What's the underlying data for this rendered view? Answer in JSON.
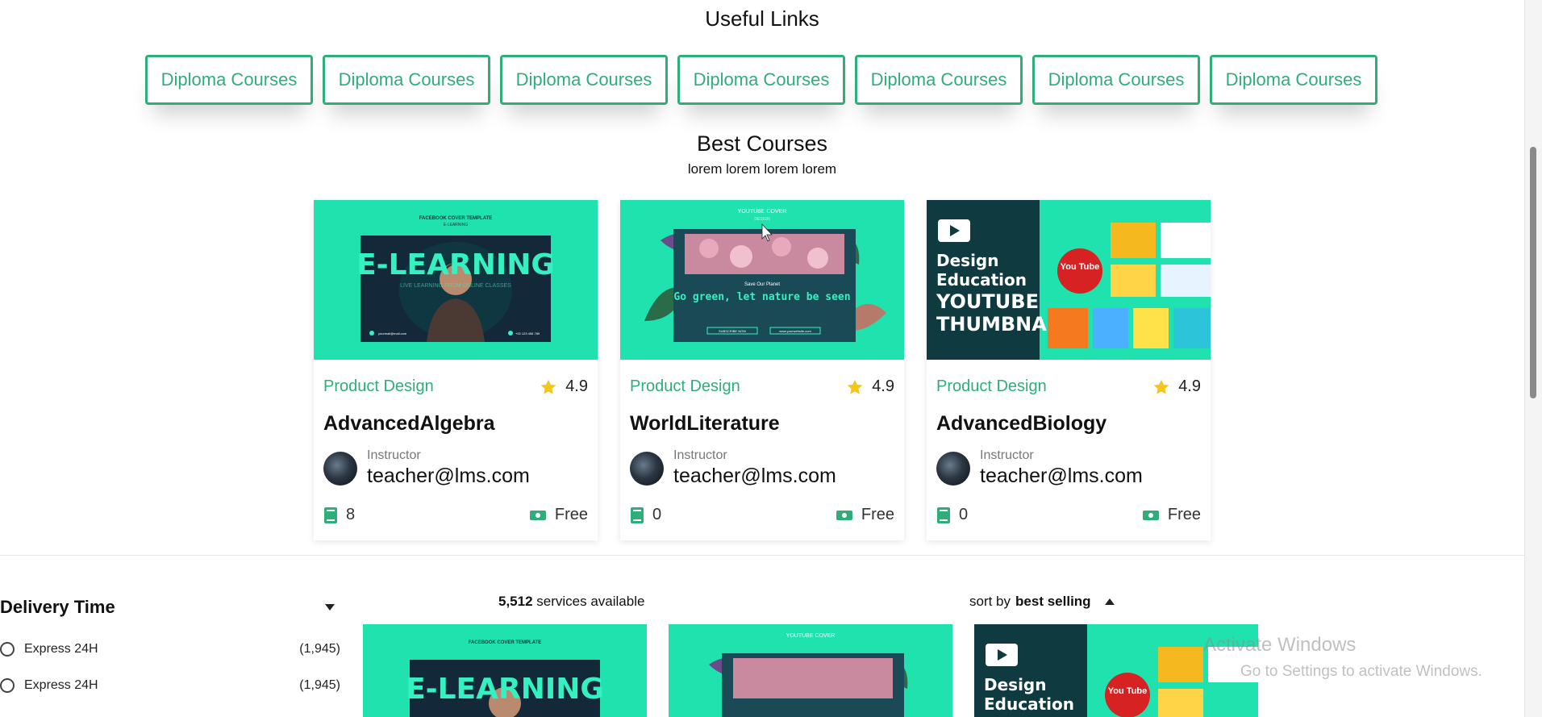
{
  "useful_links": {
    "title": "Useful Links",
    "items": [
      "Diploma Courses",
      "Diploma Courses",
      "Diploma Courses",
      "Diploma Courses",
      "Diploma Courses",
      "Diploma Courses",
      "Diploma Courses"
    ]
  },
  "best_courses": {
    "title": "Best Courses",
    "subtitle": "lorem lorem lorem lorem",
    "cards": [
      {
        "thumbnail": {
          "header": "FACEBOOK COVER TEMPLATE",
          "sub": "E-LEARNING",
          "headline": "E-LEARNING",
          "tagline": "LIVE LEARNING FROM ONLINE CLASSES",
          "email": "yourmail@mail.com",
          "phone": "+00 123 456 789"
        },
        "category": "Product Design",
        "rating": "4.9",
        "name": "AdvancedAlgebra",
        "instructor_label": "Instructor",
        "instructor_email": "teacher@lms.com",
        "lessons": "8",
        "price": "Free"
      },
      {
        "thumbnail": {
          "header": "YOUTUBE COVER",
          "sub": "DESIGN",
          "small": "Save Our Planet",
          "headline": "Go green, let nature be seen",
          "pill1": "SUBSCRIBE NOW",
          "pill2": "www.yourwebsite.com"
        },
        "category": "Product Design",
        "rating": "4.9",
        "name": "WorldLiterature",
        "instructor_label": "Instructor",
        "instructor_email": "teacher@lms.com",
        "lessons": "0",
        "price": "Free"
      },
      {
        "thumbnail": {
          "line1": "Design",
          "line2": "Education",
          "line3": "YOUTUBE",
          "line4": "THUMBNAIL",
          "badge": "You Tube"
        },
        "category": "Product Design",
        "rating": "4.9",
        "name": "AdvancedBiology",
        "instructor_label": "Instructor",
        "instructor_email": "teacher@lms.com",
        "lessons": "0",
        "price": "Free"
      }
    ]
  },
  "filter": {
    "title": "Delivery Time",
    "options": [
      {
        "label": "Express 24H",
        "count": "(1,945)"
      },
      {
        "label": "Express 24H",
        "count": "(1,945)"
      }
    ]
  },
  "results": {
    "count": "5,512",
    "count_suffix": " services available",
    "sort_prefix": "sort by ",
    "sort_value": "best selling"
  },
  "preview_cards": [
    {
      "header": "FACEBOOK COVER TEMPLATE",
      "headline": "E-LEARNING"
    },
    {
      "header": "YOUTUBE COVER"
    },
    {
      "line1": "Design",
      "line2": "Education",
      "badge": "You Tube"
    }
  ],
  "watermark": {
    "line1": "Activate Windows",
    "line2": "Go to Settings to activate Windows."
  },
  "colors": {
    "accent": "#2fae7a",
    "thumb_bg": "#1fe2ae",
    "dark_panel": "#0f3a3f",
    "star": "#f5c518"
  },
  "icons": [
    "star-icon",
    "book-icon",
    "money-icon",
    "caret-down-icon",
    "caret-up-icon",
    "play-icon"
  ]
}
